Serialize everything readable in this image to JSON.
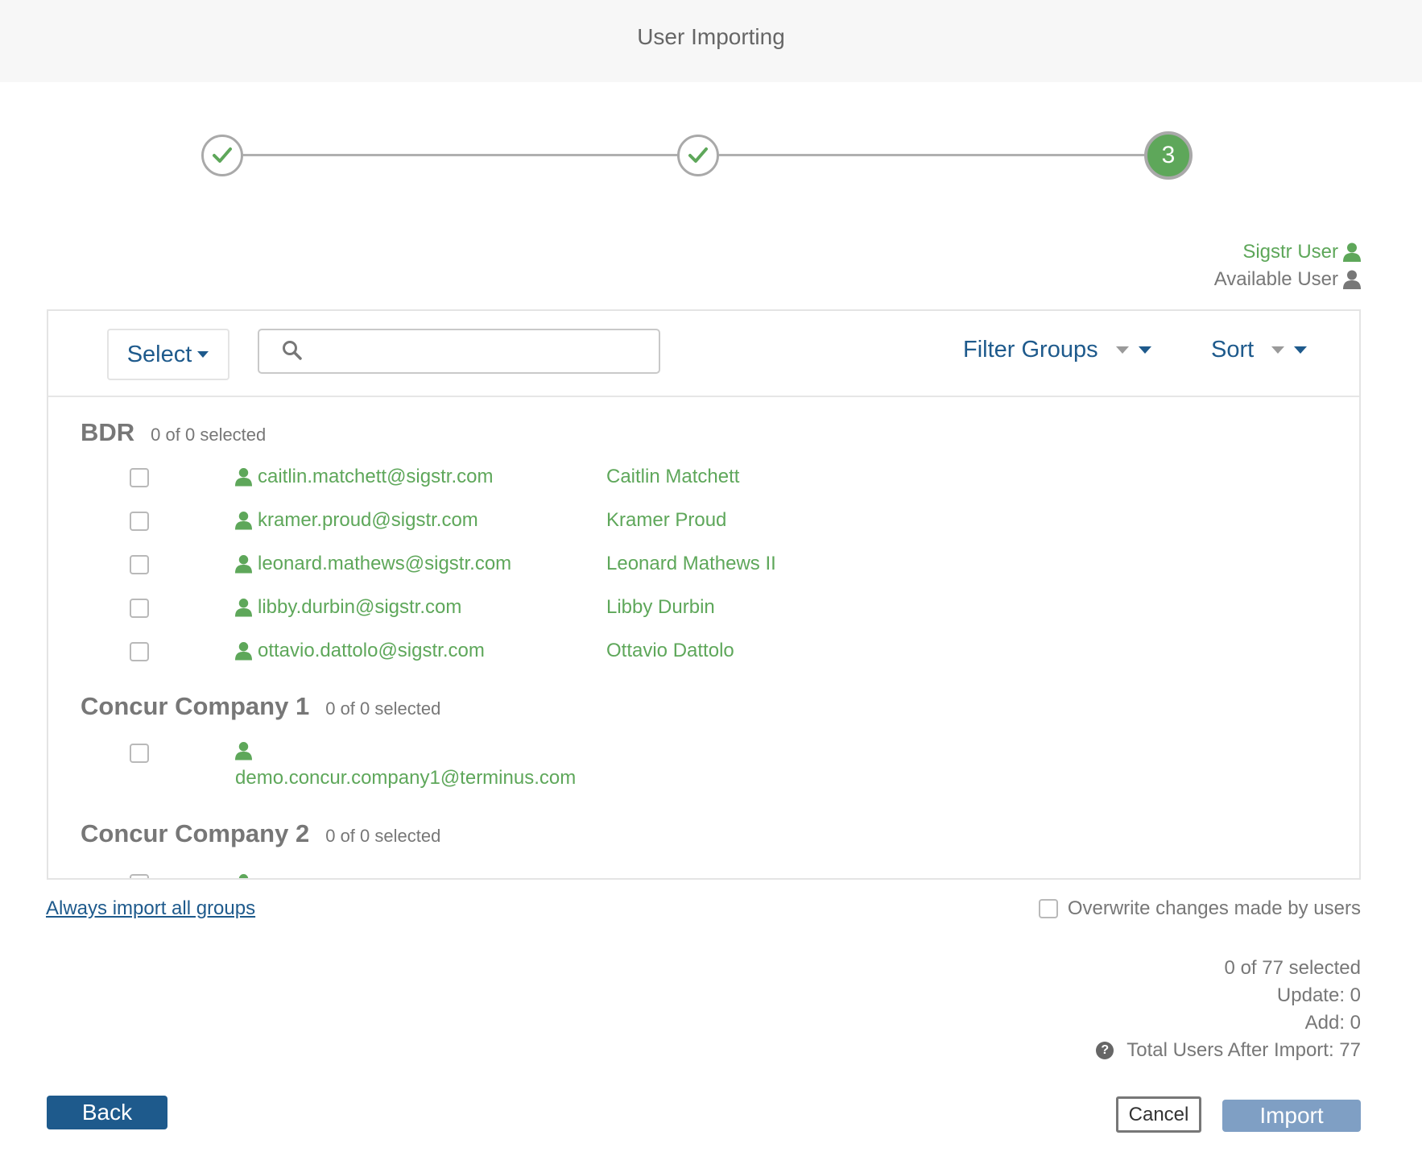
{
  "header": {
    "title": "User Importing"
  },
  "stepper": {
    "current_step": "3"
  },
  "legend": {
    "sigstr_user": "Sigstr User",
    "available_user": "Available User"
  },
  "toolbar": {
    "select_label": "Select",
    "search_placeholder": "",
    "filter_groups_label": "Filter Groups",
    "sort_label": "Sort"
  },
  "groups": [
    {
      "name": "BDR",
      "count": "0 of 0 selected",
      "users": [
        {
          "email": "caitlin.matchett@sigstr.com",
          "name": "Caitlin Matchett"
        },
        {
          "email": "kramer.proud@sigstr.com",
          "name": "Kramer Proud"
        },
        {
          "email": "leonard.mathews@sigstr.com",
          "name": "Leonard Mathews II"
        },
        {
          "email": "libby.durbin@sigstr.com",
          "name": "Libby Durbin"
        },
        {
          "email": "ottavio.dattolo@sigstr.com",
          "name": "Ottavio Dattolo"
        }
      ]
    },
    {
      "name": "Concur Company 1",
      "count": "0 of 0 selected",
      "users": [
        {
          "email": "demo.concur.company1@terminus.com",
          "name": ""
        }
      ]
    },
    {
      "name": "Concur Company 2",
      "count": "0 of 0 selected",
      "users": []
    }
  ],
  "footer": {
    "always_import_link": "Always import all groups",
    "overwrite_label": "Overwrite changes made by users",
    "selected_summary": "0 of 77 selected",
    "update": "Update: 0",
    "add": "Add: 0",
    "total_after_import": "Total Users After Import: 77",
    "back_label": "Back",
    "cancel_label": "Cancel",
    "import_label": "Import"
  },
  "colors": {
    "brand_blue": "#1e5a8c",
    "sigstr_green": "#5ea75a",
    "import_disabled": "#7f9fc4"
  },
  "icons": [
    "check-icon",
    "user-icon",
    "search-icon",
    "caret-down-icon",
    "help-icon"
  ]
}
